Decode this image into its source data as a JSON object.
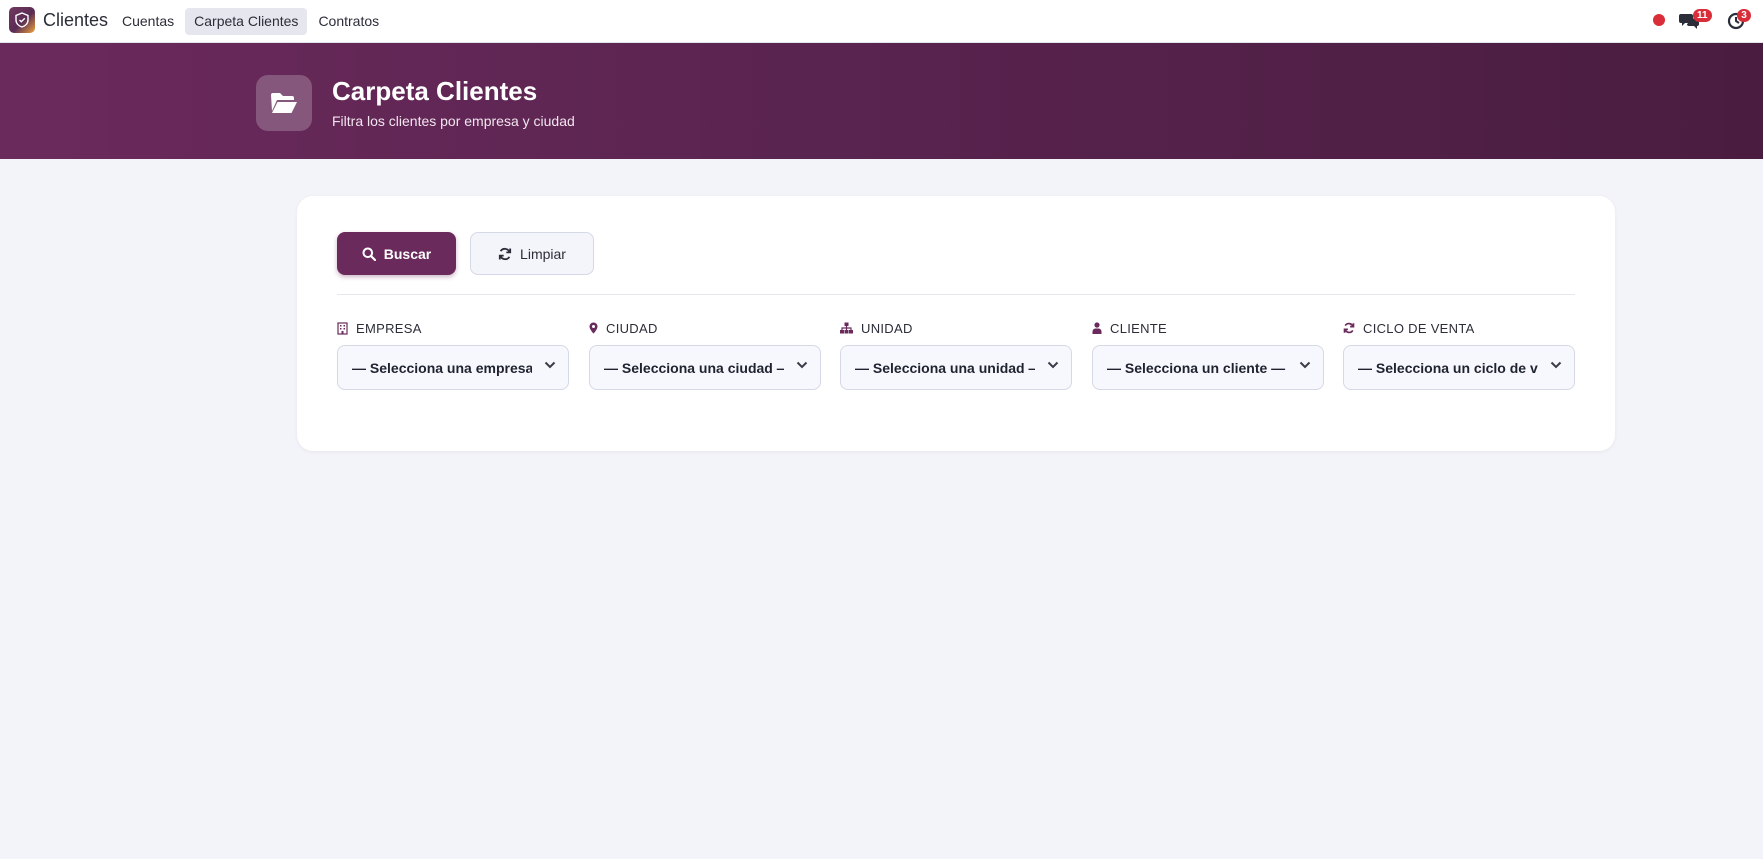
{
  "navbar": {
    "app_name": "Clientes",
    "menu": [
      {
        "label": "Cuentas",
        "active": false
      },
      {
        "label": "Carpeta Clientes",
        "active": true
      },
      {
        "label": "Contratos",
        "active": false
      }
    ],
    "systray": {
      "status_color": "#d92d3a",
      "messages_count": "11",
      "activities_count": "3"
    }
  },
  "header": {
    "title": "Carpeta Clientes",
    "subtitle": "Filtra los clientes por empresa y ciudad",
    "icon": "folder-open-icon"
  },
  "toolbar": {
    "search_label": "Buscar",
    "search_icon": "search-icon",
    "clear_label": "Limpiar",
    "clear_icon": "refresh-icon"
  },
  "filters": [
    {
      "label": "EMPRESA",
      "icon": "building-icon",
      "value": "— Selecciona una empresa —"
    },
    {
      "label": "CIUDAD",
      "icon": "map-marker-icon",
      "value": "— Selecciona una ciudad —"
    },
    {
      "label": "UNIDAD",
      "icon": "sitemap-icon",
      "value": "— Selecciona una unidad —"
    },
    {
      "label": "CLIENTE",
      "icon": "user-icon",
      "value": "— Selecciona un cliente —"
    },
    {
      "label": "CICLO DE VENTA",
      "icon": "refresh-icon",
      "value": "— Selecciona un ciclo de venta —"
    }
  ],
  "colors": {
    "brand": "#6b2a5c",
    "badge": "#d92d3a",
    "background": "#f3f4f9"
  }
}
